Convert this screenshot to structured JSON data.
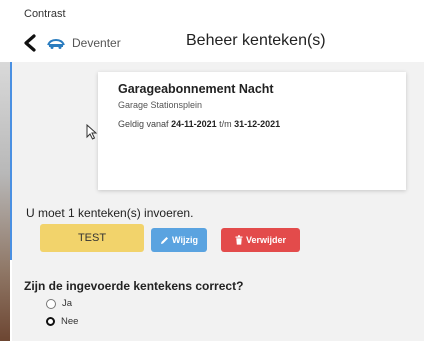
{
  "app": {
    "name": "Contrast",
    "location": "Deventer",
    "page_title": "Beheer kenteken(s)"
  },
  "subscription": {
    "title": "Garageabonnement Nacht",
    "garage": "Garage Stationsplein",
    "valid_from_label": "Geldig vanaf",
    "valid_from": "24-11-2021",
    "until_label": "t/m",
    "valid_until": "31-12-2021"
  },
  "plates": {
    "instruction": "U moet 1 kenteken(s) invoeren.",
    "value": "TEST",
    "edit_label": "Wijzig",
    "delete_label": "Verwijder"
  },
  "confirmation": {
    "question": "Zijn de ingevoerde kentekens correct?",
    "options": [
      {
        "label": "Ja",
        "checked": false
      },
      {
        "label": "Nee",
        "checked": true
      }
    ]
  },
  "colors": {
    "plate": "#f2d36b",
    "edit": "#5aa3e0",
    "delete": "#e34b4b",
    "accent": "#4a90e2"
  },
  "icons": {
    "back": "chevron-left-icon",
    "location": "car-icon",
    "edit": "pencil-icon",
    "delete": "trash-icon",
    "cursor": "mouse-cursor-icon"
  }
}
